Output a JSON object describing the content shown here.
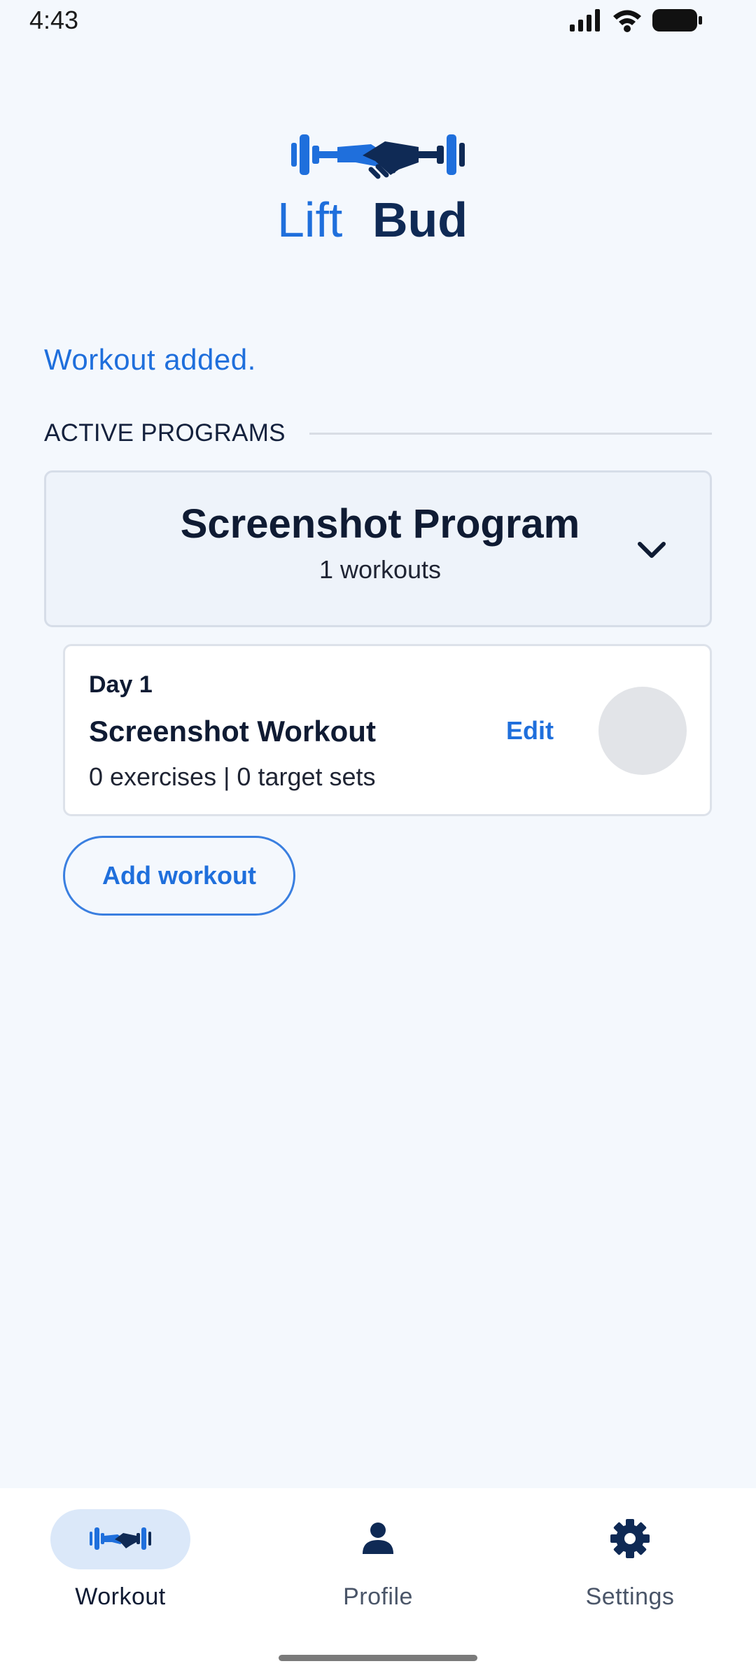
{
  "status_bar": {
    "time": "4:43"
  },
  "logo": {
    "word_1": "Lift",
    "word_2": "Bud",
    "colors": {
      "primary_blue": "#1f6fdc",
      "dark_navy": "#0f2a55"
    }
  },
  "notice": "Workout added.",
  "section": {
    "title": "ACTIVE PROGRAMS"
  },
  "program": {
    "title": "Screenshot Program",
    "subtitle": "1 workouts",
    "toggle_icon": "chevron-down-icon"
  },
  "workout": {
    "day": "Day 1",
    "name": "Screenshot Workout",
    "meta": "0 exercises | 0 target sets",
    "edit_label": "Edit"
  },
  "add_workout_label": "Add workout",
  "nav": {
    "items": [
      {
        "label": "Workout",
        "icon": "dumbbell-handshake-icon",
        "active": true
      },
      {
        "label": "Profile",
        "icon": "person-icon",
        "active": false
      },
      {
        "label": "Settings",
        "icon": "gear-icon",
        "active": false
      }
    ]
  },
  "colors": {
    "background": "#f4f8fd",
    "accent": "#1f6fdc",
    "text_dark": "#0f1b33",
    "nav_active_pill": "#dbe8f9"
  }
}
